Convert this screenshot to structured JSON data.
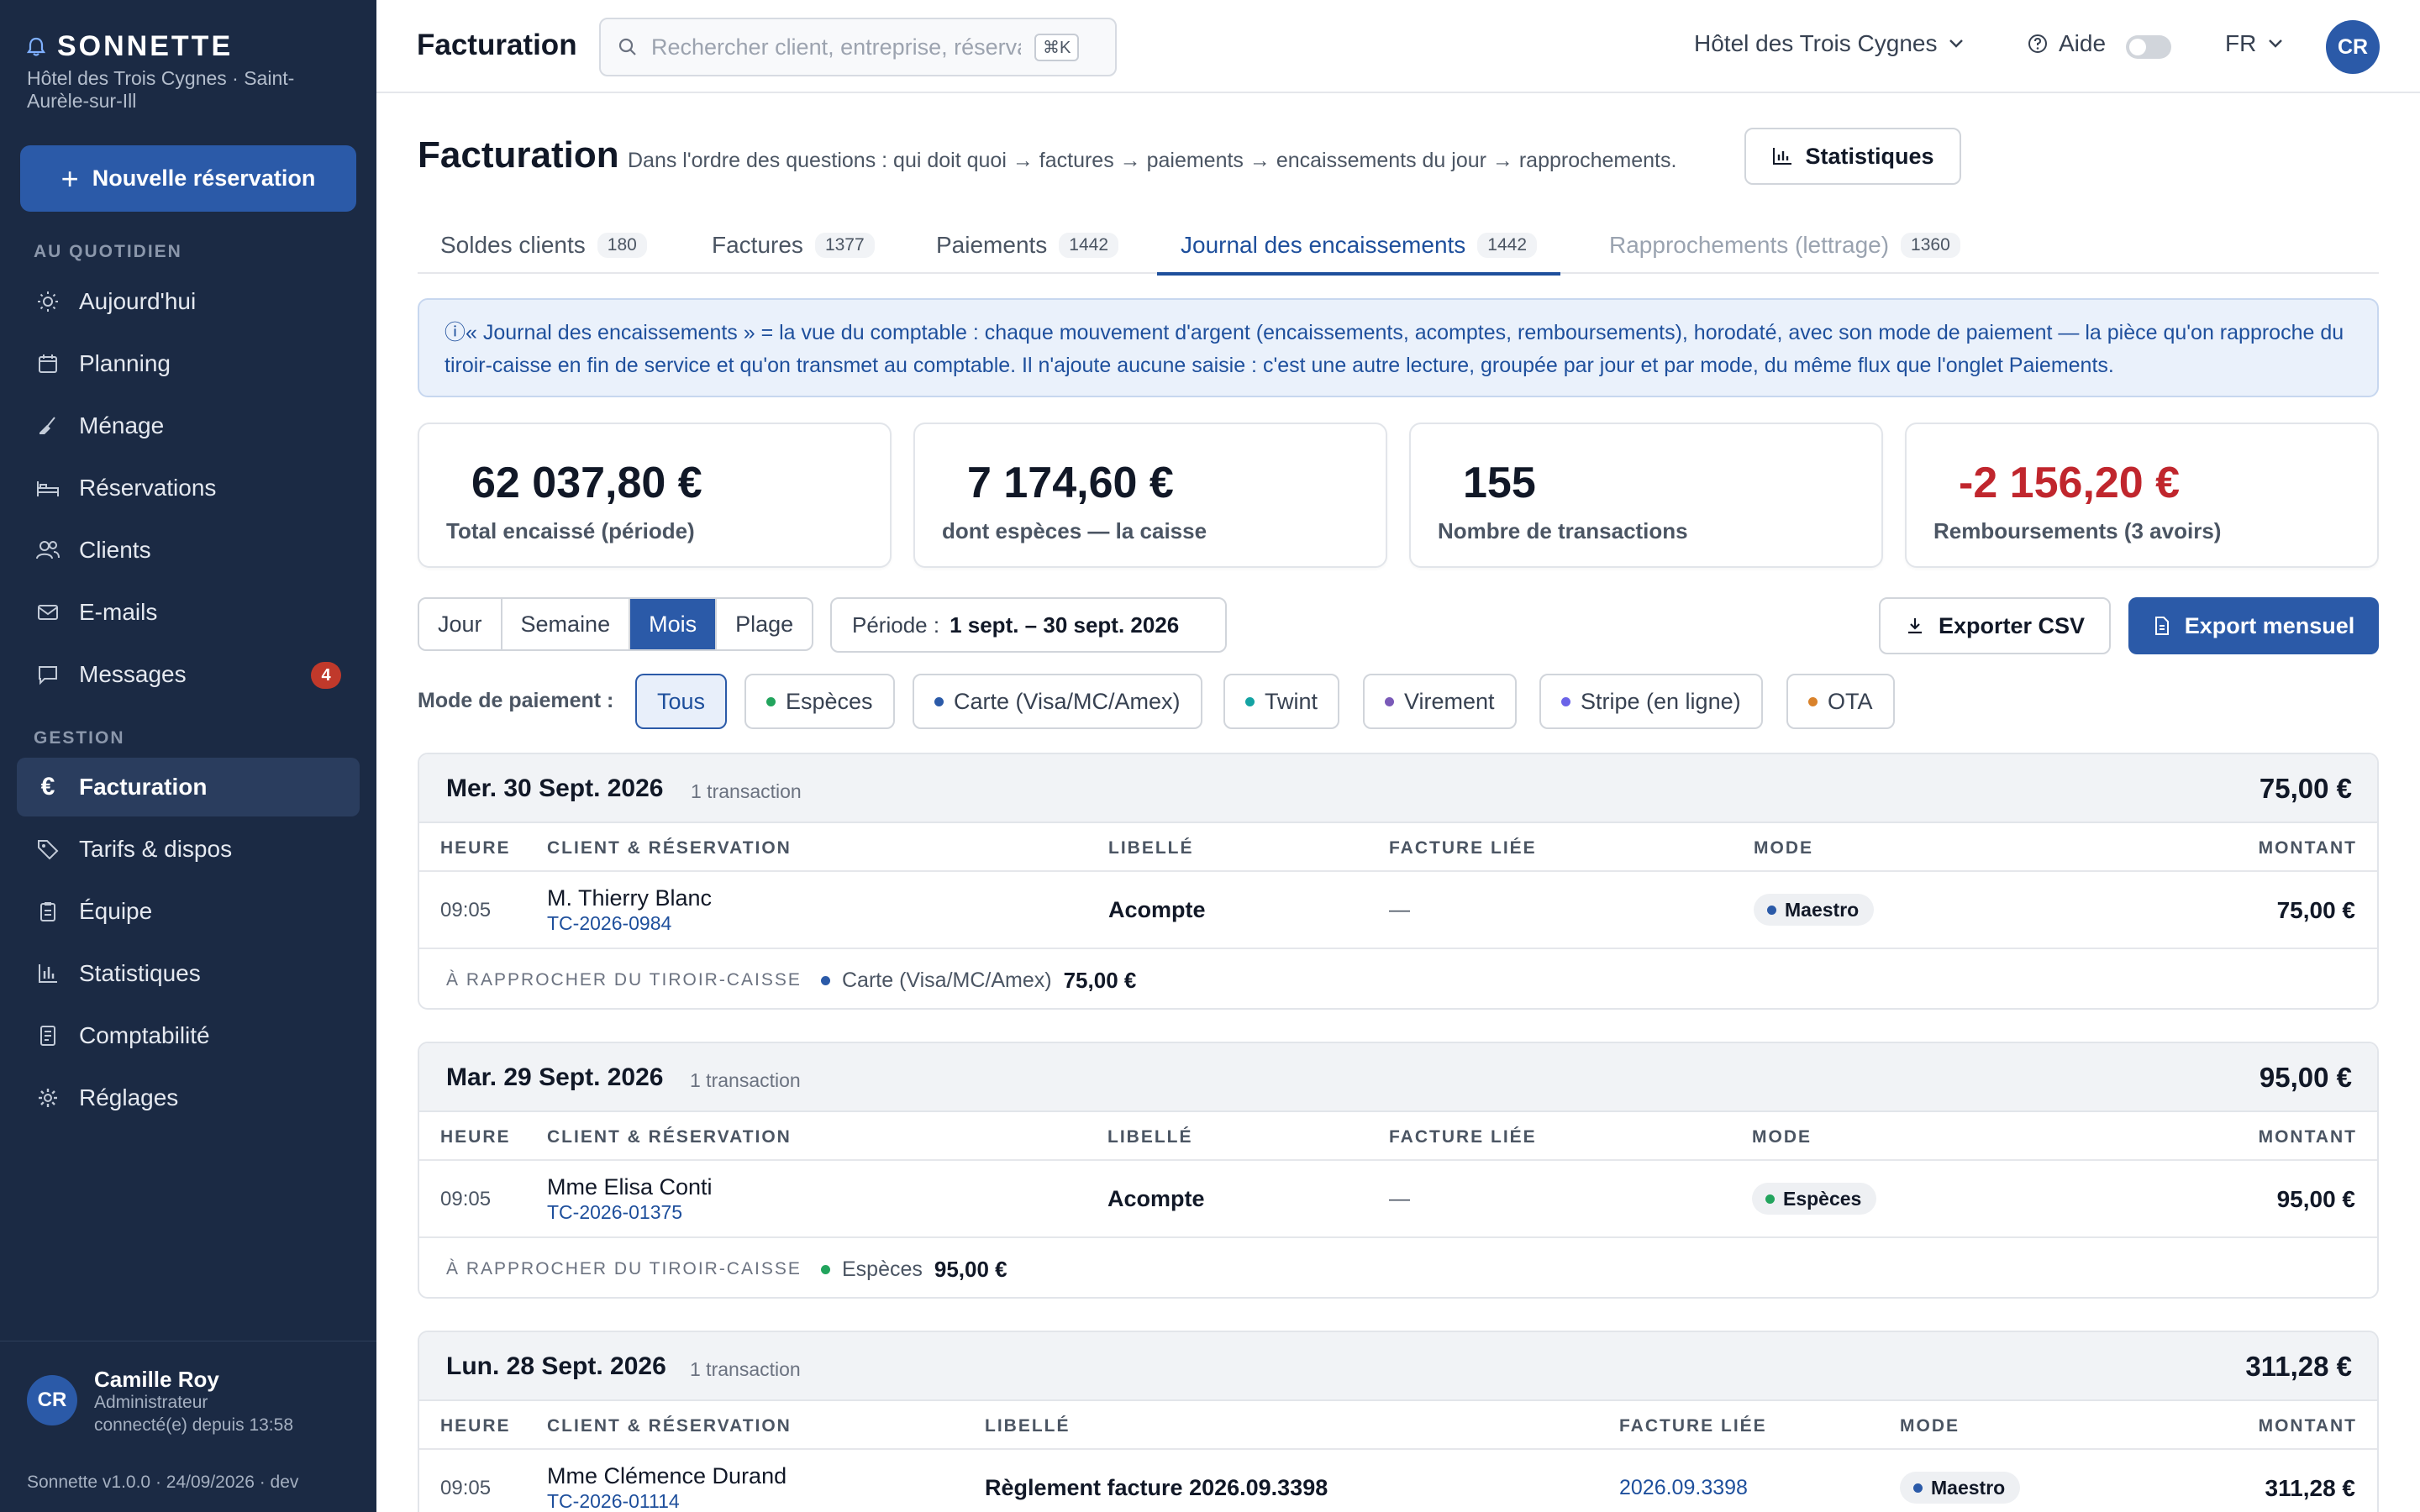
{
  "app": {
    "brand": "SONNETTE",
    "hotel_sub": "Hôtel des Trois Cygnes · Saint-Aurèle-sur-Ill",
    "new_reservation": "Nouvelle réservation"
  },
  "sidebar": {
    "section_daily": "AU QUOTIDIEN",
    "section_gestion": "GESTION",
    "items": [
      {
        "label": "Aujourd'hui",
        "icon": "sun-icon"
      },
      {
        "label": "Planning",
        "icon": "calendar-icon"
      },
      {
        "label": "Ménage",
        "icon": "broom-icon"
      },
      {
        "label": "Réservations",
        "icon": "bed-icon"
      },
      {
        "label": "Clients",
        "icon": "users-icon"
      },
      {
        "label": "E-mails",
        "icon": "mail-icon"
      },
      {
        "label": "Messages",
        "icon": "chat-icon",
        "badge": "4"
      },
      {
        "label": "Facturation",
        "icon": "euro-icon",
        "active": true
      },
      {
        "label": "Tarifs & dispos",
        "icon": "tag-icon"
      },
      {
        "label": "Équipe",
        "icon": "clipboard-icon"
      },
      {
        "label": "Statistiques",
        "icon": "bar-chart-icon"
      },
      {
        "label": "Comptabilité",
        "icon": "ledger-icon"
      },
      {
        "label": "Réglages",
        "icon": "gear-icon"
      }
    ],
    "user": {
      "initials": "CR",
      "name": "Camille Roy",
      "role": "Administrateur",
      "since": "connecté(e) depuis 13:58"
    },
    "version": "Sonnette v1.0.0 · 24/09/2026 · dev"
  },
  "topbar": {
    "title": "Facturation",
    "search_placeholder": "Rechercher client, entreprise, réservation…",
    "search_shortcut": "⌘K",
    "hotel": "Hôtel des Trois Cygnes",
    "help": "Aide",
    "lang": "FR",
    "avatar": "CR"
  },
  "page": {
    "title": "Facturation",
    "subtitle": "Dans l'ordre des questions : qui doit quoi → factures → paiements → encaissements du jour → rapprochements.",
    "stats_button": "Statistiques",
    "tabs": [
      {
        "label": "Soldes clients",
        "count": "180"
      },
      {
        "label": "Factures",
        "count": "1377"
      },
      {
        "label": "Paiements",
        "count": "1442"
      },
      {
        "label": "Journal des encaissements",
        "count": "1442"
      },
      {
        "label": "Rapprochements (lettrage)",
        "count": "1360"
      }
    ],
    "info": "ⓘ« Journal des encaissements » = la vue du comptable : chaque mouvement d'argent (encaissements, acomptes, remboursements), horodaté, avec son mode de paiement — la pièce qu'on rapproche du tiroir-caisse en fin de service et qu'on transmet au comptable. Il n'ajoute aucune saisie : c'est une autre lecture, groupée par jour et par mode, du même flux que l'onglet Paiements.",
    "kpis": [
      {
        "value": "62 037,80 €",
        "label": "Total encaissé (période)"
      },
      {
        "value": "7 174,60 €",
        "label": "dont espèces — la caisse"
      },
      {
        "value": "155",
        "label": "Nombre de transactions"
      },
      {
        "value": "-2 156,20 €",
        "label": "Remboursements (3 avoirs)"
      }
    ],
    "granularity": [
      "Jour",
      "Semaine",
      "Mois",
      "Plage"
    ],
    "period_label": "Période :",
    "period_value": "1 sept. – 30 sept. 2026",
    "export_csv": "Exporter CSV",
    "export_month": "Export mensuel",
    "mode_label": "Mode de paiement :",
    "modes": [
      {
        "label": "Tous",
        "color": ""
      },
      {
        "label": "Espèces",
        "color": "#22a45d"
      },
      {
        "label": "Carte (Visa/MC/Amex)",
        "color": "#2b5aa8"
      },
      {
        "label": "Twint",
        "color": "#14a3a3"
      },
      {
        "label": "Virement",
        "color": "#7a5ab8"
      },
      {
        "label": "Stripe (en ligne)",
        "color": "#6b63e8"
      },
      {
        "label": "OTA",
        "color": "#d9822b"
      }
    ],
    "columns": {
      "time": "HEURE",
      "client": "CLIENT & RÉSERVATION",
      "label": "LIBELLÉ",
      "invoice": "FACTURE LIÉE",
      "mode": "MODE",
      "amount": "MONTANT"
    },
    "foot_label": "À RAPPROCHER DU TIROIR-CAISSE",
    "days": [
      {
        "date": "Mer. 30 Sept. 2026",
        "count": "1 transaction",
        "total": "75,00 €",
        "row": {
          "time": "09:05",
          "client": "M. Thierry Blanc",
          "ref": "TC-2026-0984",
          "label": "Acompte",
          "invoice": "—",
          "mode": "Maestro",
          "mode_color": "#2b5aa8",
          "amount": "75,00 €"
        },
        "foot": {
          "mode": "Carte (Visa/MC/Amex)",
          "color": "#2b5aa8",
          "amount": "75,00 €"
        }
      },
      {
        "date": "Mar. 29 Sept. 2026",
        "count": "1 transaction",
        "total": "95,00 €",
        "row": {
          "time": "09:05",
          "client": "Mme Elisa Conti",
          "ref": "TC-2026-01375",
          "label": "Acompte",
          "invoice": "—",
          "mode": "Espèces",
          "mode_color": "#22a45d",
          "amount": "95,00 €"
        },
        "foot": {
          "mode": "Espèces",
          "color": "#22a45d",
          "amount": "95,00 €"
        }
      },
      {
        "date": "Lun. 28 Sept. 2026",
        "count": "1 transaction",
        "total": "311,28 €",
        "row": {
          "time": "09:05",
          "client": "Mme Clémence Durand",
          "ref": "TC-2026-01114",
          "label": "Règlement facture 2026.09.3398",
          "invoice": "2026.09.3398",
          "mode": "Maestro",
          "mode_color": "#2b5aa8",
          "amount": "311,28 €"
        }
      }
    ]
  }
}
